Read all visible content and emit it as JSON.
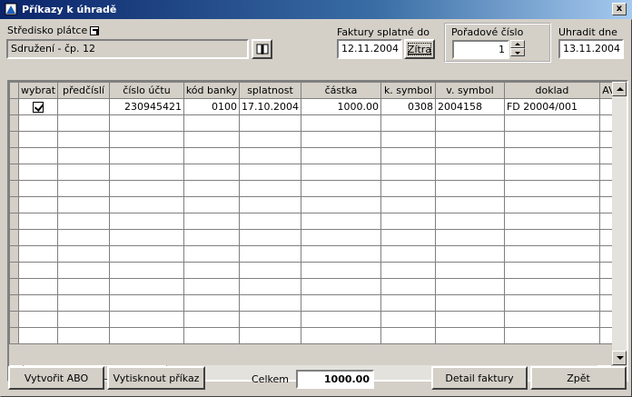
{
  "window": {
    "title": "Příkazy k úhradě",
    "close_label": "x"
  },
  "header": {
    "stredisko_label": "Středisko plátce",
    "stredisko_value": "Sdružení - čp. 12",
    "faktury_label": "Faktury splatné do",
    "faktury_value": "12.11.2004",
    "zitra_label": "Zítra",
    "poradove_label": "Pořadové číslo",
    "poradove_value": "1",
    "uhradit_label": "Uhradit dne",
    "uhradit_value": "13.11.2004"
  },
  "table": {
    "columns": [
      "wybrat",
      "předčíslí",
      "číslo účtu",
      "kód banky",
      "splatnost",
      "částka",
      "k. symbol",
      "v. symbol",
      "doklad",
      "AV"
    ],
    "rows": [
      {
        "checked": true,
        "predcisli": "",
        "cislo_uctu": "230945421",
        "kod_banky": "0100",
        "splatnost": "17.10.2004",
        "castka": "1000.00",
        "k_symbol": "0308",
        "v_symbol": "2004158",
        "doklad": "FD 20004/001",
        "av": ""
      }
    ]
  },
  "footer": {
    "vytvorit_label": "Vytvořit ABO",
    "vytisknout_label": "Vytisknout příkaz",
    "celkem_label": "Celkem",
    "celkem_value": "1000.00",
    "detail_label": "Detail faktury",
    "zpet_label": "Zpět"
  }
}
